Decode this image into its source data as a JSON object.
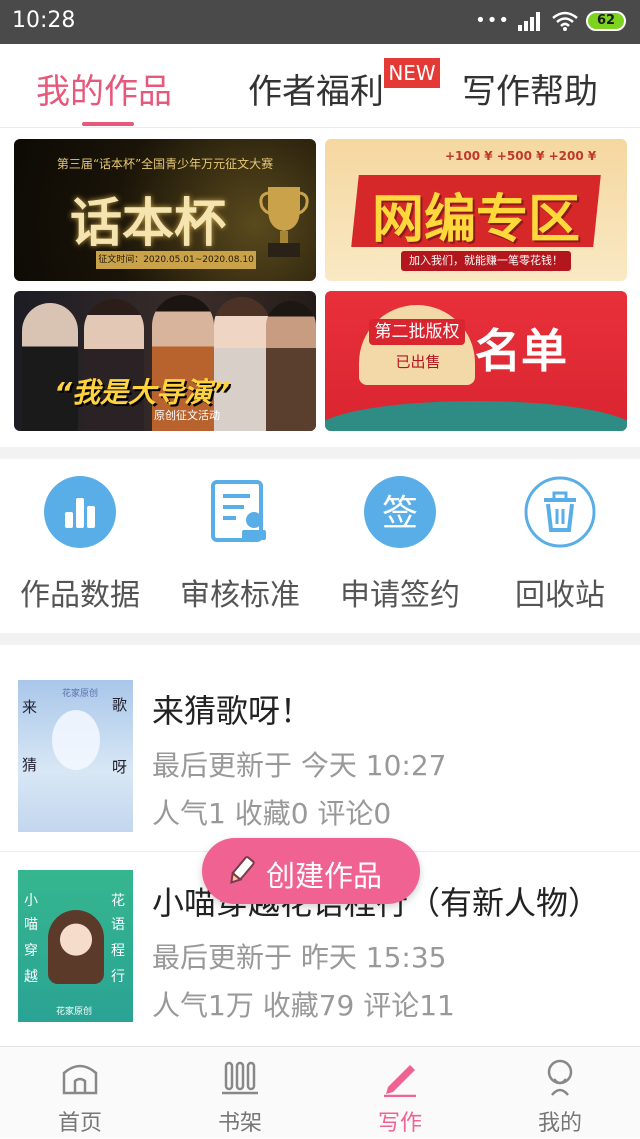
{
  "status_bar": {
    "time": "10:28",
    "battery": "62"
  },
  "tabs": [
    {
      "label": "我的作品",
      "active": true
    },
    {
      "label": "作者福利",
      "badge": "NEW"
    },
    {
      "label": "写作帮助"
    }
  ],
  "banners": [
    {
      "top_text": "第三届“话本杯”全国青少年万元征文大赛",
      "main_text": "话本杯",
      "sub_text": "征文时间：2020.05.01~2020.08.10"
    },
    {
      "top_text": "+100 ¥  +500 ¥  +200 ¥",
      "main_text": "网编专区",
      "sub_text": "加入我们，就能赚一笔零花钱！"
    },
    {
      "main_text": "“我是大导演”",
      "sub_text": "原创征文活动"
    },
    {
      "top_text": "第二批版权",
      "sub_text": "已出售",
      "main_text": "名单"
    }
  ],
  "features": [
    {
      "label": "作品数据",
      "icon": "bar-chart-icon"
    },
    {
      "label": "审核标准",
      "icon": "document-check-icon"
    },
    {
      "label": "申请签约",
      "icon": "sign-icon",
      "icon_text": "签"
    },
    {
      "label": "回收站",
      "icon": "trash-icon"
    }
  ],
  "works": [
    {
      "title": "来猜歌呀！",
      "updated": "最后更新于 今天 10:27",
      "stats": "人气1 收藏0 评论0",
      "cover": {
        "badge": "花家原创",
        "chars": [
          "来",
          "歌",
          "猜",
          "呀"
        ]
      }
    },
    {
      "title": "小喵穿越花语程行（有新人物）",
      "updated": "最后更新于 昨天 15:35",
      "stats": "人气1万 收藏79 评论11",
      "cover": {
        "badge": "花家原创",
        "chars": [
          "小",
          "花",
          "喵",
          "语",
          "穿",
          "程",
          "越",
          "行"
        ]
      }
    }
  ],
  "fab": {
    "label": "创建作品"
  },
  "bottom_nav": [
    {
      "label": "首页",
      "icon": "home-icon"
    },
    {
      "label": "书架",
      "icon": "bookshelf-icon"
    },
    {
      "label": "写作",
      "icon": "pen-icon",
      "active": true
    },
    {
      "label": "我的",
      "icon": "profile-icon"
    }
  ],
  "colors": {
    "accent": "#e5597b",
    "fab": "#f06292",
    "icon_blue": "#5aaee8",
    "status_bar": "#4a4a4a"
  }
}
